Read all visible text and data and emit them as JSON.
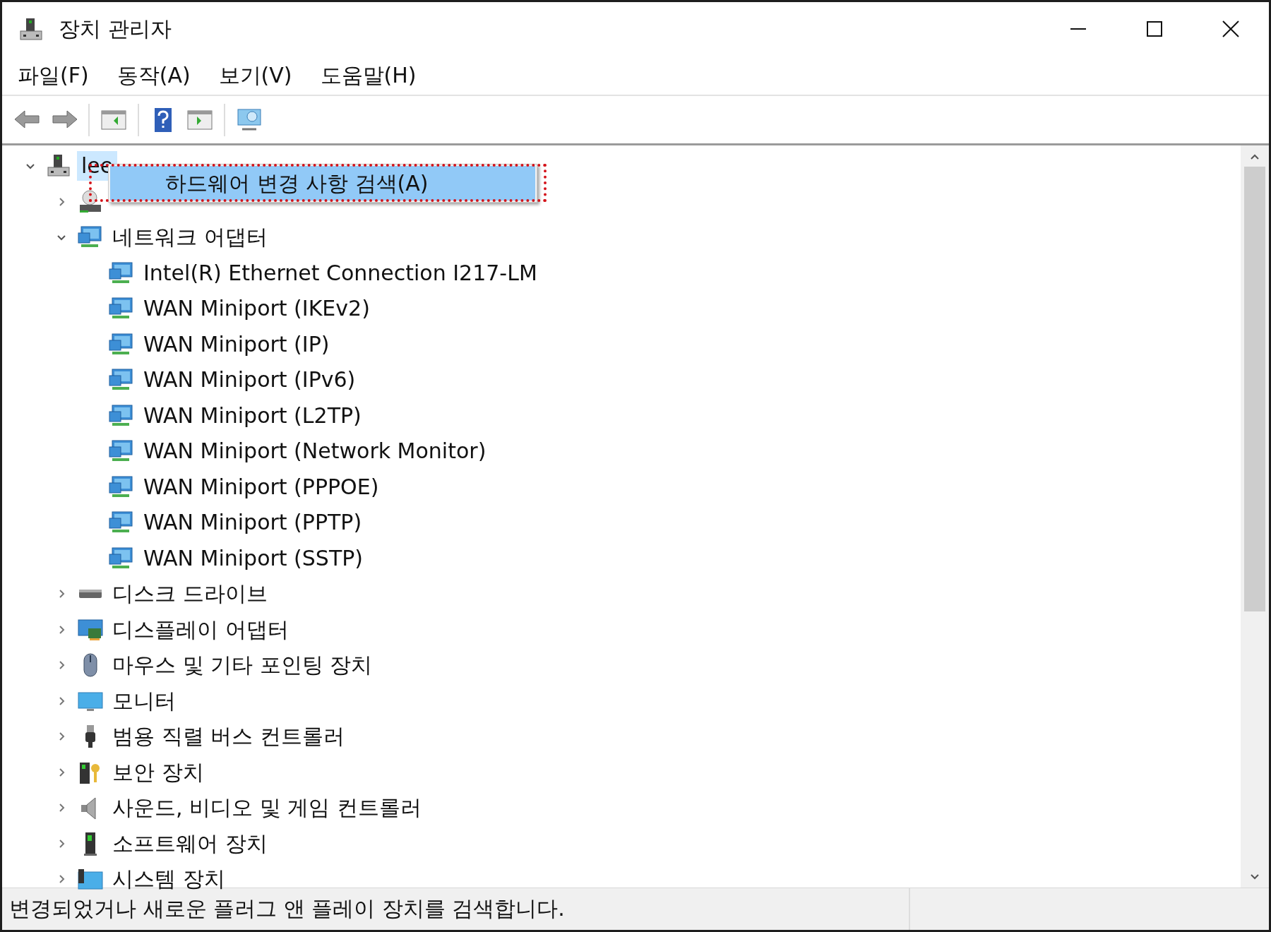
{
  "window": {
    "title": "장치 관리자"
  },
  "menu": [
    {
      "label": "파일(F)"
    },
    {
      "label": "동작(A)"
    },
    {
      "label": "보기(V)"
    },
    {
      "label": "도움말(H)"
    }
  ],
  "tree": [
    {
      "label": "lee",
      "expanded": true,
      "selected": true,
      "children": [
        {
          "expanded": false,
          "selected": false
        },
        {
          "label": "네트워크 어댑터",
          "expanded": true,
          "selected": false,
          "children": [
            {
              "label": "Intel(R) Ethernet Connection I217-LM",
              "selected": false
            },
            {
              "label": "WAN Miniport (IKEv2)",
              "selected": false
            },
            {
              "label": "WAN Miniport (IP)",
              "selected": false
            },
            {
              "label": "WAN Miniport (IPv6)",
              "selected": false
            },
            {
              "label": "WAN Miniport (L2TP)",
              "selected": false
            },
            {
              "label": "WAN Miniport (Network Monitor)",
              "selected": false
            },
            {
              "label": "WAN Miniport (PPPOE)",
              "selected": false
            },
            {
              "label": "WAN Miniport (PPTP)",
              "selected": false
            },
            {
              "label": "WAN Miniport (SSTP)",
              "selected": false
            }
          ]
        },
        {
          "label": "디스크 드라이브",
          "expanded": false,
          "selected": false
        },
        {
          "label": "디스플레이 어댑터",
          "expanded": false,
          "selected": false
        },
        {
          "label": "마우스 및 기타 포인팅 장치",
          "expanded": false,
          "selected": false
        },
        {
          "label": "모니터",
          "expanded": false,
          "selected": false
        },
        {
          "label": "범용 직렬 버스 컨트롤러",
          "expanded": false,
          "selected": false
        },
        {
          "label": "보안 장치",
          "expanded": false,
          "selected": false
        },
        {
          "label": "사운드, 비디오 및 게임 컨트롤러",
          "expanded": false,
          "selected": false
        },
        {
          "label": "소프트웨어 장치",
          "expanded": false,
          "selected": false
        },
        {
          "label": "시스템 장치",
          "expanded": false,
          "selected": false
        }
      ]
    }
  ],
  "context_menu": {
    "items": [
      {
        "label": "하드웨어 변경 사항 검색(A)",
        "selected": true
      }
    ]
  },
  "status_bar": {
    "text": "변경되었거나 새로운 플러그 앤 플레이 장치를 검색합니다."
  }
}
